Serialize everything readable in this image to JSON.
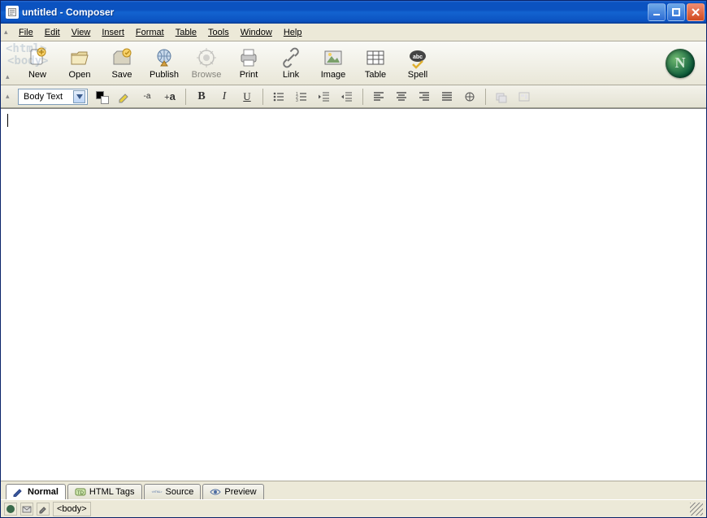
{
  "window": {
    "title": "untitled - Composer"
  },
  "menu": {
    "file": "File",
    "edit": "Edit",
    "view": "View",
    "insert": "Insert",
    "format": "Format",
    "table": "Table",
    "tools": "Tools",
    "window": "Window",
    "help": "Help"
  },
  "toolbar": {
    "new": "New",
    "open": "Open",
    "save": "Save",
    "publish": "Publish",
    "browse": "Browse",
    "print": "Print",
    "link": "Link",
    "image": "Image",
    "table": "Table",
    "spell": "Spell"
  },
  "throbber": {
    "letter": "N"
  },
  "format_toolbar": {
    "style_combo": "Body Text"
  },
  "tabs": {
    "normal": "Normal",
    "html_tags": "HTML Tags",
    "source": "Source",
    "preview": "Preview"
  },
  "status": {
    "path": "<body>"
  },
  "watermark": {
    "line1": "<html>",
    "line2": "<body>"
  }
}
